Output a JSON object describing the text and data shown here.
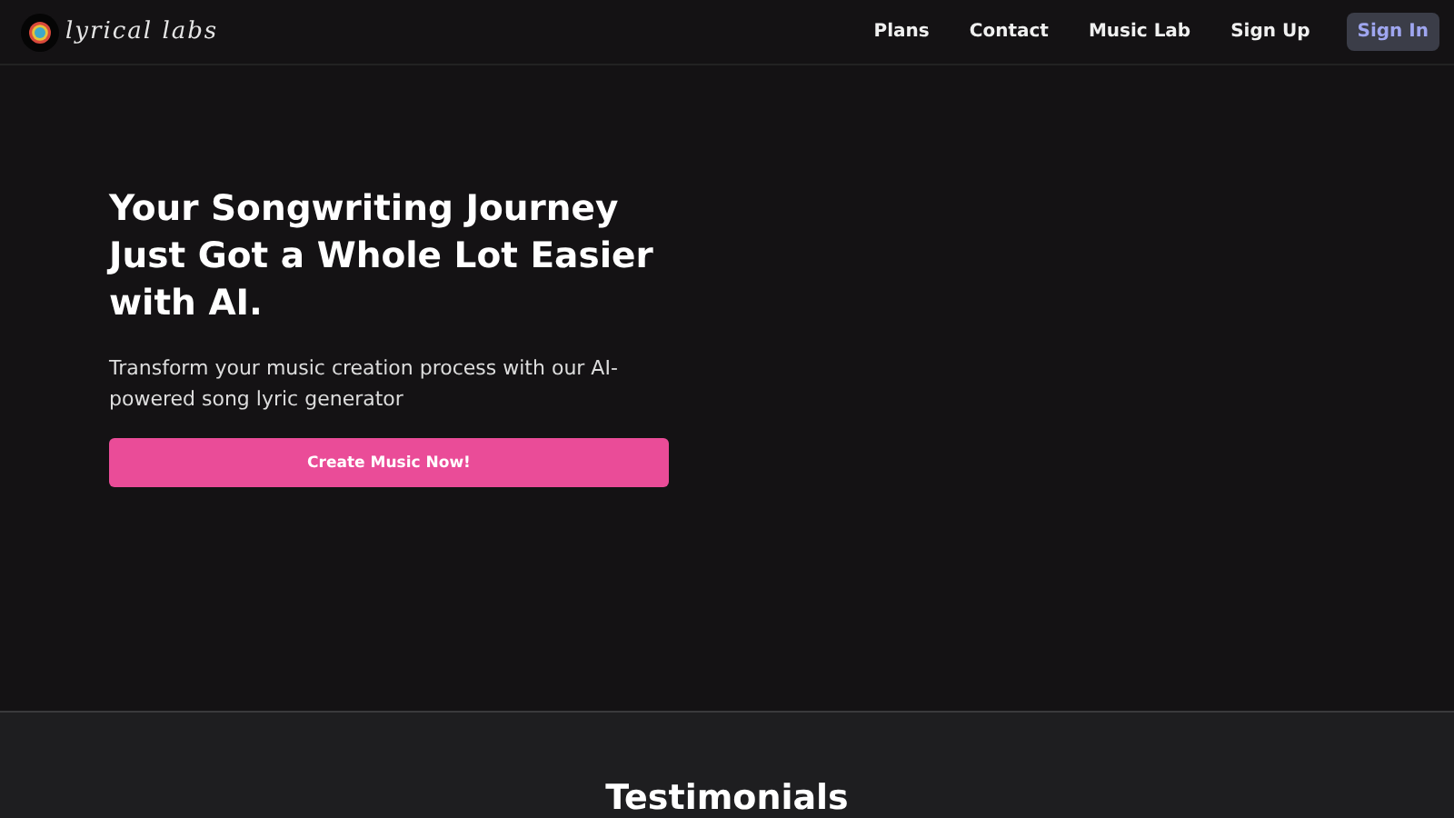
{
  "header": {
    "logo_text": "lyrical labs",
    "nav": [
      {
        "label": "Plans",
        "kind": "link"
      },
      {
        "label": "Contact",
        "kind": "link"
      },
      {
        "label": "Music Lab",
        "kind": "link"
      },
      {
        "label": "Sign Up",
        "kind": "link"
      },
      {
        "label": "Sign In",
        "kind": "button"
      }
    ]
  },
  "hero": {
    "title": "Your Songwriting Journey Just Got a Whole Lot Easier with AI.",
    "subtitle": "Transform your music creation process with our AI-powered song lyric generator",
    "cta": "Create Music Now!"
  },
  "testimonials": {
    "heading": "Testimonials"
  }
}
